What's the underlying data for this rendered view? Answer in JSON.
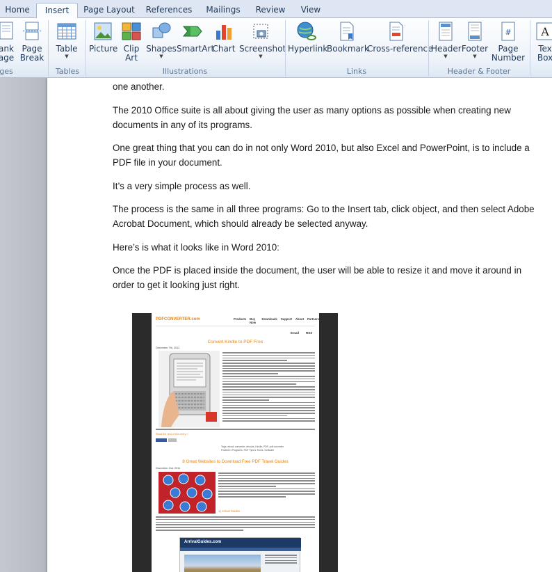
{
  "tabs": [
    {
      "label": "Home",
      "active": false
    },
    {
      "label": "Insert",
      "active": true
    },
    {
      "label": "Page Layout",
      "active": false
    },
    {
      "label": "References",
      "active": false
    },
    {
      "label": "Mailings",
      "active": false
    },
    {
      "label": "Review",
      "active": false
    },
    {
      "label": "View",
      "active": false
    }
  ],
  "ribbon": {
    "pages": {
      "blank_page": "ank\nage",
      "page_break": "Page\nBreak",
      "group": "ges"
    },
    "tables": {
      "table": "Table",
      "group": "Tables"
    },
    "illustrations": {
      "picture": "Picture",
      "clip_art": "Clip\nArt",
      "shapes": "Shapes",
      "smartart": "SmartArt",
      "chart": "Chart",
      "screenshot": "Screenshot",
      "group": "Illustrations"
    },
    "links": {
      "hyperlink": "Hyperlink",
      "bookmark": "Bookmark",
      "cross_reference": "Cross-reference",
      "group": "Links"
    },
    "header_footer": {
      "header": "Header",
      "footer": "Footer",
      "page_number": "Page\nNumber",
      "group": "Header & Footer"
    },
    "text": {
      "text_box": "Tex\nBox"
    }
  },
  "document": {
    "paragraphs": [
      "one another.",
      "The 2010  Office suite is all about giving the user as many options as possible when creating new documents in any of its programs.",
      "One great thing that you can do in not only Word 2010, but also Excel and PowerPoint, is to include a PDF file in your document.",
      "It’s a very simple process as well.",
      "The process is the same in all three programs: Go to the Insert tab, click object, and then select Adobe Acrobat Document, which should already be selected anyway.",
      "Here’s is what it looks like in Word 2010:",
      "Once the PDF is placed inside the document, the user will be able to resize it and move it around in order to get it looking just right."
    ]
  },
  "pdf": {
    "logo": "PDFCONVERTER.com",
    "nav": [
      "Products",
      "Buy Now",
      "Downloads",
      "Support",
      "About",
      "Partners"
    ],
    "email": "Email",
    "rss": "RSS",
    "post1_title": "Convert Kindle to PDF Free",
    "post1_date": "December 7th, 2011",
    "post1_more": "Read the rest of this entry »",
    "post1_tags": "Tags: ebook converter, ebooks, Kindle, PDF, pdf converter",
    "post1_posted": "Posted in Programs, PDF Tips & Tricks, Software",
    "post2_title": "8 Great Websites to Download Free PDF Travel Guides",
    "post2_date": "December 2nd, 2011",
    "post2_link": "1) Arrival Guides",
    "arrival": "ArrivalGuides.com",
    "colors": {
      "orange": "#e8820c",
      "green": "#3b7d2a"
    }
  }
}
